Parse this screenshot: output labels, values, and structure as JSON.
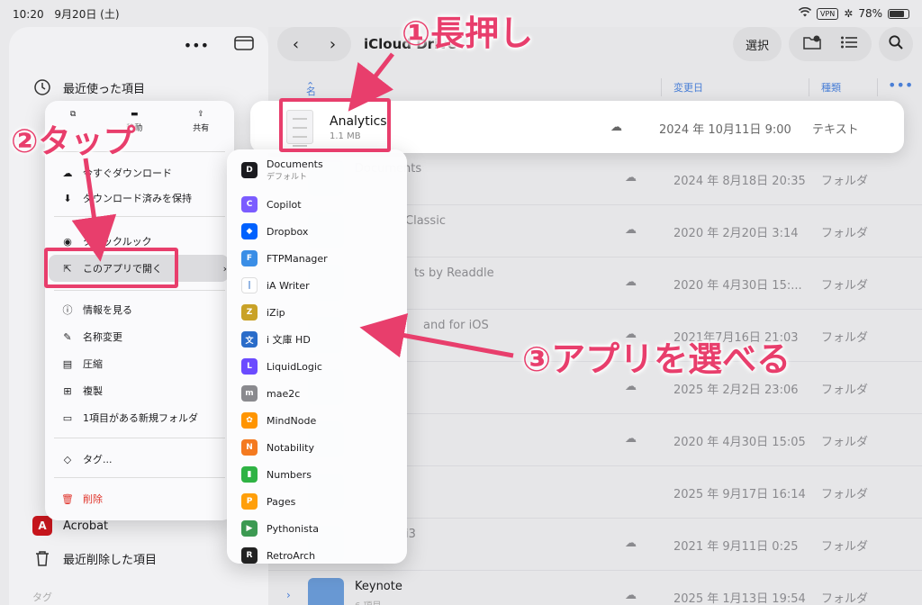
{
  "status": {
    "time": "10:20",
    "date": "9月20日 (土)",
    "vpn": "VPN",
    "battery": "78%",
    "battery_level": 0.78
  },
  "sidebar": {
    "items": [
      {
        "label": "最近使った項目"
      },
      {
        "label": "Acrobat"
      },
      {
        "label": "最近削除した項目"
      }
    ],
    "section_partial": "タグ"
  },
  "toolbar": {
    "path": "iCloud Drive",
    "select": "選択"
  },
  "columns": {
    "name": "名前",
    "modified": "変更日",
    "kind": "種類"
  },
  "rows": [
    {
      "name": "Analytics",
      "sub": "1.1 MB",
      "date": "2024 年 10月11日 9:00",
      "kind": "テキスト"
    },
    {
      "name": "Documents",
      "sub": "",
      "date": "2024 年 8月18日 20:35",
      "kind": "フォルダ"
    },
    {
      "name": "Classic",
      "sub": "",
      "date": "2020 年 2月20日 3:14",
      "kind": "フォルダ"
    },
    {
      "name": "ts by Readdle",
      "sub": "",
      "date": "2020 年 4月30日 15:...",
      "kind": "フォルダ"
    },
    {
      "name": "and for iOS",
      "sub": "",
      "date": "2021年7月16日 21:03",
      "kind": "フォルダ"
    },
    {
      "name": "",
      "sub": "",
      "date": "2025 年 2月2日 23:06",
      "kind": "フォルダ"
    },
    {
      "name": "",
      "sub": "",
      "date": "2020 年 4月30日 15:05",
      "kind": "フォルダ"
    },
    {
      "name": "",
      "sub": "",
      "date": "2025 年 9月17日 16:14",
      "kind": "フォルダ"
    },
    {
      "name": "i3",
      "sub": "",
      "date": "2021 年 9月11日 0:25",
      "kind": "フォルダ"
    },
    {
      "name": "Keynote",
      "sub": "6 項目",
      "date": "2025 年 1月13日 19:54",
      "kind": "フォルダ"
    }
  ],
  "context_menu": {
    "quick": [
      "移動",
      "共有"
    ],
    "items": [
      "今すぐダウンロード",
      "ダウンロード済みを保持",
      "クイックルック",
      "このアプリで開く",
      "情報を見る",
      "名称変更",
      "圧縮",
      "複製",
      "1項目がある新規フォルダ",
      "タグ...",
      "削除"
    ]
  },
  "apps": [
    {
      "name": "Documents",
      "sub": "デフォルト",
      "color": "#1b1b1f",
      "glyph": "D"
    },
    {
      "name": "Copilot",
      "sub": "",
      "color": "#7b5cff",
      "glyph": "C"
    },
    {
      "name": "Dropbox",
      "sub": "",
      "color": "#0061fe",
      "glyph": "◆"
    },
    {
      "name": "FTPManager",
      "sub": "",
      "color": "#3a8ee6",
      "glyph": "F"
    },
    {
      "name": "iA Writer",
      "sub": "",
      "color": "#ffffff",
      "glyph": "|"
    },
    {
      "name": "iZip",
      "sub": "",
      "color": "#c9a227",
      "glyph": "Z"
    },
    {
      "name": "i 文庫 HD",
      "sub": "",
      "color": "#2a6cc9",
      "glyph": "文"
    },
    {
      "name": "LiquidLogic",
      "sub": "",
      "color": "#6b4bff",
      "glyph": "L"
    },
    {
      "name": "mae2c",
      "sub": "",
      "color": "#8a8a8e",
      "glyph": "m"
    },
    {
      "name": "MindNode",
      "sub": "",
      "color": "#ff9500",
      "glyph": "✿"
    },
    {
      "name": "Notability",
      "sub": "",
      "color": "#f47a20",
      "glyph": "N"
    },
    {
      "name": "Numbers",
      "sub": "",
      "color": "#2fb344",
      "glyph": "▮"
    },
    {
      "name": "Pages",
      "sub": "",
      "color": "#ff9f0a",
      "glyph": "P"
    },
    {
      "name": "Pythonista",
      "sub": "",
      "color": "#3c9a52",
      "glyph": "▶"
    },
    {
      "name": "RetroArch",
      "sub": "",
      "color": "#222222",
      "glyph": "R"
    }
  ],
  "annotations": {
    "step1": "①長押し",
    "step2": "②タップ",
    "step3": "③アプリを選べる"
  }
}
